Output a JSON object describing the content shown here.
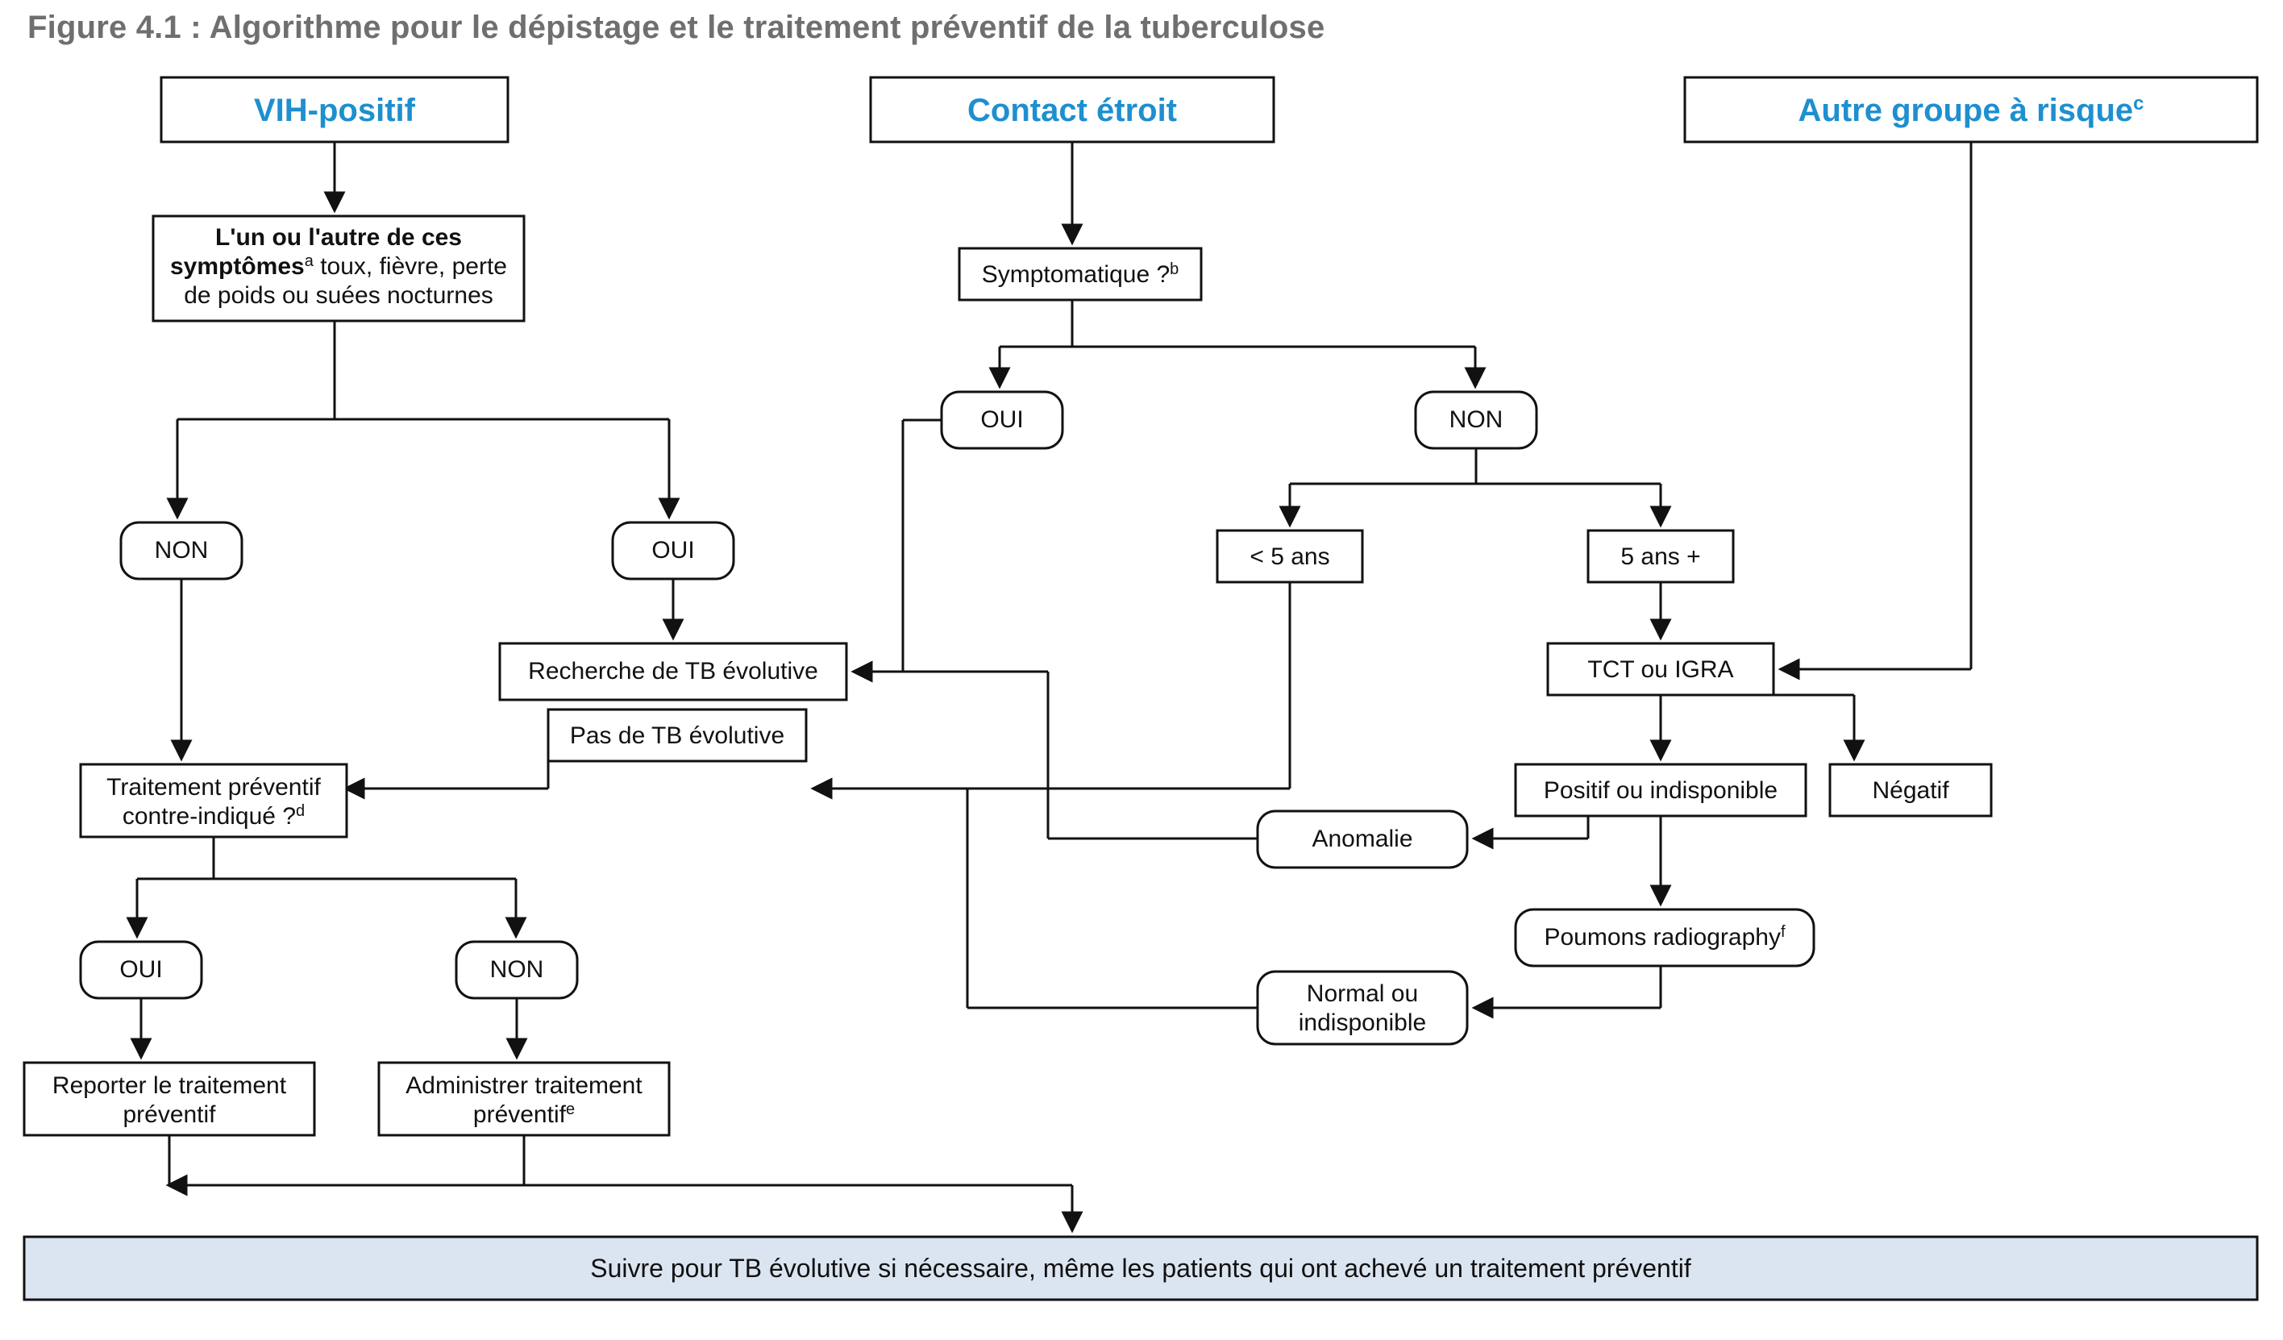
{
  "title": "Figure 4.1 : Algorithme pour le dépistage et le traitement préventif de la tuberculose",
  "entries": {
    "hiv": "VIH-positif",
    "contact": "Contact étroit",
    "other": "Autre groupe à risque",
    "other_sup": "c"
  },
  "hiv_symptoms_line1a": "L'un ou l'autre de ces",
  "hiv_symptoms_line1b": "symptômes",
  "hiv_symptoms_sup": "a",
  "hiv_symptoms_line2a": " toux, fièvre, perte",
  "hiv_symptoms_line3": "de poids ou suées nocturnes",
  "symptomatic": "Symptomatique ?",
  "symptomatic_sup": "b",
  "oui": "OUI",
  "non": "NON",
  "lt5": "< 5 ans",
  "ge5": "5 ans +",
  "tct_igra": "TCT ou IGRA",
  "pos_or_unavail": "Positif ou indisponible",
  "negative": "Négatif",
  "cxr": "Poumons radiography",
  "cxr_sup": "f",
  "abnormal": "Anomalie",
  "normal_line1": "Normal ou",
  "normal_line2": "indisponible",
  "investigate_tb": "Recherche de TB évolutive",
  "no_active_tb": "Pas de TB évolutive",
  "contra_line1": "Traitement préventif",
  "contra_line2": "contre-indiqué ?",
  "contra_sup": "d",
  "defer_line1": "Reporter le traitement",
  "defer_line2": "préventif",
  "give_line1": "Administrer traitement",
  "give_line2": "préventif",
  "give_sup": "e",
  "followup": "Suivre pour TB évolutive si nécessaire, même les patients qui ont achevé un traitement préventif"
}
